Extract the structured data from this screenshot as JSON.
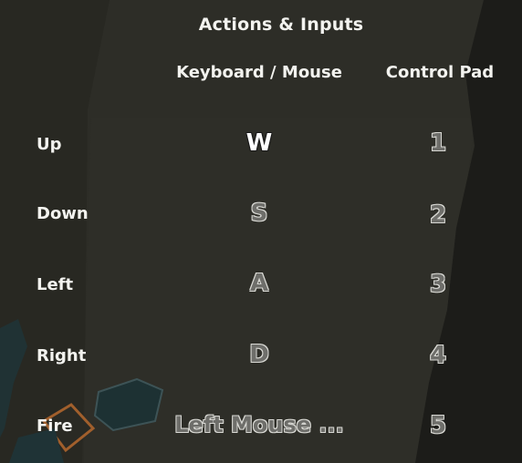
{
  "header": {
    "title": "Actions & Inputs"
  },
  "columns": {
    "keyboard": "Keyboard / Mouse",
    "pad": "Control Pad"
  },
  "rows": [
    {
      "action": "Up",
      "keyboard": "W",
      "pad": "1"
    },
    {
      "action": "Down",
      "keyboard": "S",
      "pad": "2"
    },
    {
      "action": "Left",
      "keyboard": "A",
      "pad": "3"
    },
    {
      "action": "Right",
      "keyboard": "D",
      "pad": "4"
    },
    {
      "action": "Fire",
      "keyboard": "Left Mouse ...",
      "pad": "5"
    }
  ],
  "colors": {
    "background": "#2a2a24",
    "text": "#f3f3ef",
    "key_inactive": "#6e6e6a"
  }
}
